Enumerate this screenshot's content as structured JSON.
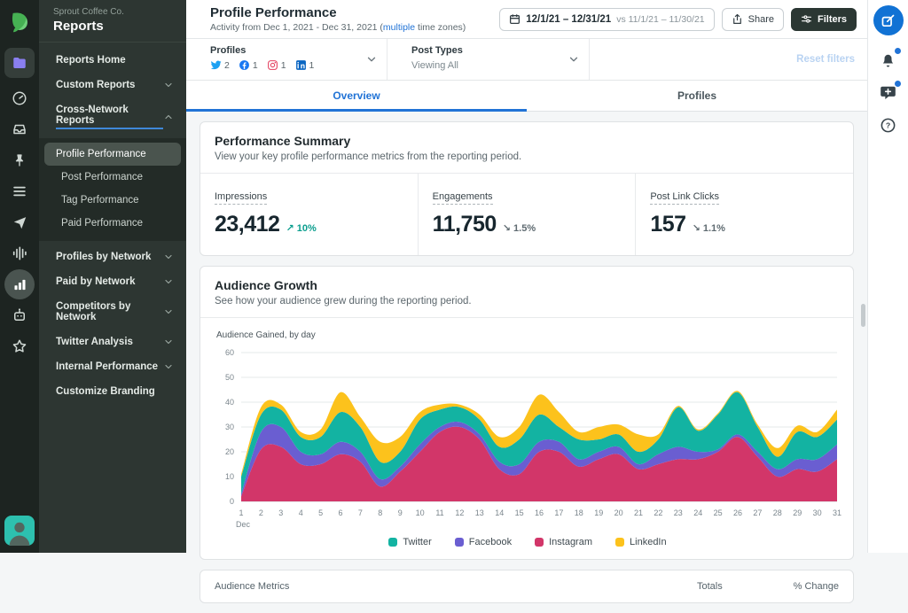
{
  "colors": {
    "accent_blue": "#2173d6",
    "sidebar_dark": "#2d3632",
    "rail_dark": "#1d2421",
    "positive_green": "#0b9e8e",
    "reset_disabled_blue": "#b9d3f2",
    "dark_button": "#2b3733"
  },
  "icon_rail": {
    "items": [
      {
        "icon": "sprout-leaf-logo",
        "logo": true
      },
      {
        "icon": "reports-folder-icon",
        "active": true
      },
      {
        "icon": "gauge-icon"
      },
      {
        "icon": "inbox-icon"
      },
      {
        "icon": "pin-icon"
      },
      {
        "icon": "list-icon"
      },
      {
        "icon": "paper-plane-icon"
      },
      {
        "icon": "waveform-icon"
      },
      {
        "icon": "bar-chart-icon",
        "circled": true
      },
      {
        "icon": "bot-icon"
      },
      {
        "icon": "star-icon"
      }
    ]
  },
  "sidebar": {
    "company": "Sprout Coffee Co.",
    "title": "Reports",
    "items": [
      {
        "label": "Reports Home",
        "kind": "link"
      },
      {
        "label": "Custom Reports",
        "kind": "group",
        "chevron": "down"
      },
      {
        "label": "Cross-Network Reports",
        "kind": "group",
        "chevron": "up",
        "current": true
      },
      {
        "label": "Profile Performance",
        "kind": "subitem",
        "selected": true
      },
      {
        "label": "Post Performance",
        "kind": "subitem"
      },
      {
        "label": "Tag Performance",
        "kind": "subitem"
      },
      {
        "label": "Paid Performance",
        "kind": "subitem"
      },
      {
        "label": "Profiles by Network",
        "kind": "group",
        "chevron": "down"
      },
      {
        "label": "Paid by Network",
        "kind": "group",
        "chevron": "down"
      },
      {
        "label": "Competitors by Network",
        "kind": "group",
        "chevron": "down"
      },
      {
        "label": "Twitter Analysis",
        "kind": "group",
        "chevron": "down"
      },
      {
        "label": "Internal Performance",
        "kind": "group",
        "chevron": "down"
      },
      {
        "label": "Customize Branding",
        "kind": "link"
      }
    ]
  },
  "header": {
    "title": "Profile Performance",
    "subtitle_prefix": "Activity from Dec 1, 2021 - Dec 31, 2021 (",
    "subtitle_link": "multiple",
    "subtitle_suffix": " time zones)",
    "date_range": "12/1/21 – 12/31/21",
    "compare_label": "vs 11/1/21 – 11/30/21",
    "share_label": "Share",
    "filters_label": "Filters"
  },
  "filter_bar": {
    "profiles_label": "Profiles",
    "profiles": [
      {
        "network": "twitter",
        "count": "2",
        "color": "#1da1f2"
      },
      {
        "network": "facebook",
        "count": "1",
        "color": "#1877f2"
      },
      {
        "network": "instagram",
        "count": "1",
        "color": "#e4405f"
      },
      {
        "network": "linkedin",
        "count": "1",
        "color": "#0a66c2"
      }
    ],
    "post_types_label": "Post Types",
    "post_types_value": "Viewing All",
    "reset_label": "Reset filters"
  },
  "tabs": [
    {
      "label": "Overview",
      "active": true
    },
    {
      "label": "Profiles",
      "active": false
    }
  ],
  "performance_summary": {
    "title": "Performance Summary",
    "description": "View your key profile performance metrics from the reporting period.",
    "metrics": [
      {
        "label": "Impressions",
        "value": "23,412",
        "change": "10%",
        "direction": "up"
      },
      {
        "label": "Engagements",
        "value": "11,750",
        "change": "1.5%",
        "direction": "down"
      },
      {
        "label": "Post Link Clicks",
        "value": "157",
        "change": "1.1%",
        "direction": "down"
      }
    ]
  },
  "audience_growth": {
    "title": "Audience Growth",
    "description": "See how your audience grew during the reporting period.",
    "chart_label": "Audience Gained, by day"
  },
  "chart_data": {
    "type": "area",
    "stacked": true,
    "title": "Audience Gained, by day",
    "x": [
      1,
      2,
      3,
      4,
      5,
      6,
      7,
      8,
      9,
      10,
      11,
      12,
      13,
      14,
      15,
      16,
      17,
      18,
      19,
      20,
      21,
      22,
      23,
      24,
      25,
      26,
      27,
      28,
      29,
      30,
      31
    ],
    "x_month_label": "Dec",
    "ylim": [
      0,
      60
    ],
    "yticks": [
      0,
      10,
      20,
      30,
      40,
      50,
      60
    ],
    "grid": true,
    "legend_position": "bottom",
    "stack_order": [
      "Instagram",
      "Facebook",
      "Twitter",
      "LinkedIn"
    ],
    "series": [
      {
        "name": "Twitter",
        "color": "#13b3a2",
        "values": [
          7,
          7,
          7,
          6,
          7,
          12,
          10,
          7,
          6,
          10,
          7,
          6,
          6,
          6,
          10,
          11,
          6,
          8,
          5,
          5,
          5,
          6,
          16,
          8.5,
          14,
          17,
          10,
          5,
          11,
          9,
          10
        ]
      },
      {
        "name": "Facebook",
        "color": "#6a5ed1",
        "values": [
          1,
          7,
          8,
          5,
          4,
          5,
          4,
          3,
          2,
          3,
          2,
          2,
          2,
          3,
          4,
          4,
          4,
          3,
          3,
          3,
          2,
          4,
          5,
          3,
          1,
          1,
          2,
          3,
          4,
          5,
          6
        ]
      },
      {
        "name": "Instagram",
        "color": "#d23669",
        "values": [
          2,
          21,
          22,
          15,
          15,
          19,
          16,
          6,
          12,
          20,
          28,
          30,
          25,
          13,
          11,
          20,
          20,
          14,
          17,
          19,
          13,
          15,
          17,
          17,
          20,
          26,
          18,
          10,
          13,
          12,
          17
        ]
      },
      {
        "name": "LinkedIn",
        "color": "#fcc21c",
        "values": [
          1,
          3,
          2,
          2,
          3,
          8,
          4,
          8,
          6,
          3,
          2,
          1,
          2,
          4,
          5,
          8,
          6,
          3,
          5,
          4,
          7,
          2,
          0.5,
          0.5,
          0.5,
          0.5,
          1,
          3.5,
          2.5,
          2,
          4
        ]
      }
    ]
  },
  "audience_table": {
    "headers": [
      "Audience Metrics",
      "Totals",
      "% Change"
    ]
  },
  "right_rail": {
    "items": [
      {
        "icon": "compose-icon",
        "primary": true
      },
      {
        "icon": "bell-icon",
        "badge": true
      },
      {
        "icon": "chat-add-icon",
        "badge": true
      },
      {
        "icon": "help-icon"
      }
    ]
  }
}
